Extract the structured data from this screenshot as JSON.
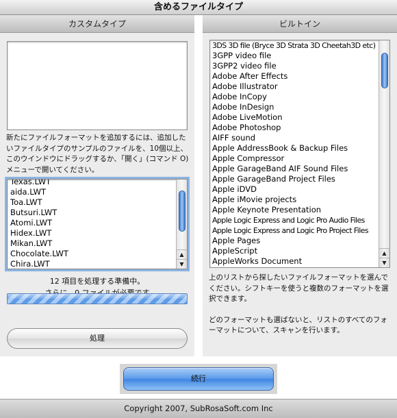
{
  "window": {
    "title": "含めるファイルタイプ"
  },
  "left_panel": {
    "header": "カスタムタイプ",
    "instructions": "新たにファイルフォーマットを追加するには、追加したいファイルタイプのサンプルのファイルを、10個以上、このウインドウにドラッグするか、「開く」(コマンド O)メニューで開いてください。",
    "files": [
      "Texas.LWT",
      "aida.LWT",
      "Toa.LWT",
      "Butsuri.LWT",
      "Atomi.LWT",
      "Hidex.LWT",
      "Mikan.LWT",
      "Chocolate.LWT",
      "Chira.LWT"
    ],
    "status_line1": "12 項目を処理する準備中。",
    "status_line2": "さらに、0 ファイルが必要です",
    "process_button": "処理"
  },
  "right_panel": {
    "header": "ビルトイン",
    "formats": [
      "3DS 3D file (Bryce 3D Strata 3D Cheetah3D etc)",
      "3GPP video file",
      "3GPP2 video file",
      "Adobe After Effects",
      "Adobe Illustrator",
      "Adobe InCopy",
      "Adobe InDesign",
      "Adobe LiveMotion",
      "Adobe Photoshop",
      "AIFF sound",
      "Apple AddressBook & Backup Files",
      "Apple Compressor",
      "Apple GarageBand AIF Sound Files",
      "Apple GarageBand Project Files",
      "Apple iDVD",
      "Apple iMovie projects",
      "Apple Keynote Presentation",
      "Apple Logic Express and Logic Pro Audio Files",
      "Apple Logic Express and Logic Pro Project Files",
      "Apple Pages",
      "AppleScript",
      "AppleWorks Document"
    ],
    "description_1": "上のリストから探したいファイルフォーマットを選んでください。シフトキーを使うと複数のフォーマットを選択できます。",
    "description_2": "どのフォーマットも選ばないと、リストのすべてのフォーマットについて、スキャンを行います。"
  },
  "continue_button": "続行",
  "footer": "Copyright 2007, SubRosaSoft.com Inc",
  "colors": {
    "accent": "#4a8de6",
    "panel": "#ececec"
  }
}
